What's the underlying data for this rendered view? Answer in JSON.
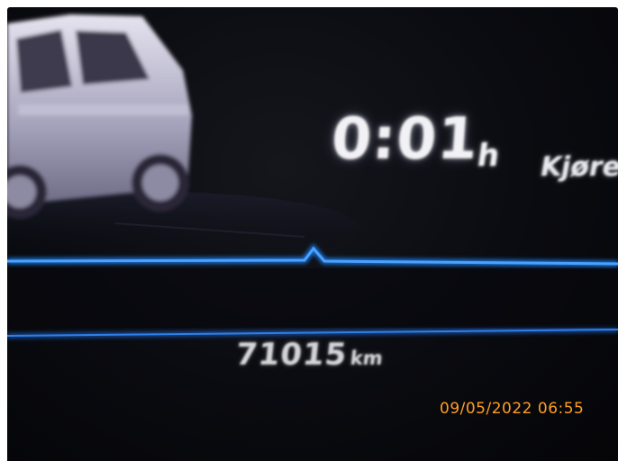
{
  "dashboard": {
    "trip_time": "0:01",
    "trip_time_unit": "h",
    "trip_label": "Kjøre",
    "odometer_value": "71015",
    "odometer_unit": "km"
  },
  "photo_timestamp": "09/05/2022  06:55",
  "colors": {
    "display_text": "#f2f2f6",
    "accent_line": "#1f7ff0",
    "timestamp": "#ff9e22",
    "background": "#07080c"
  }
}
